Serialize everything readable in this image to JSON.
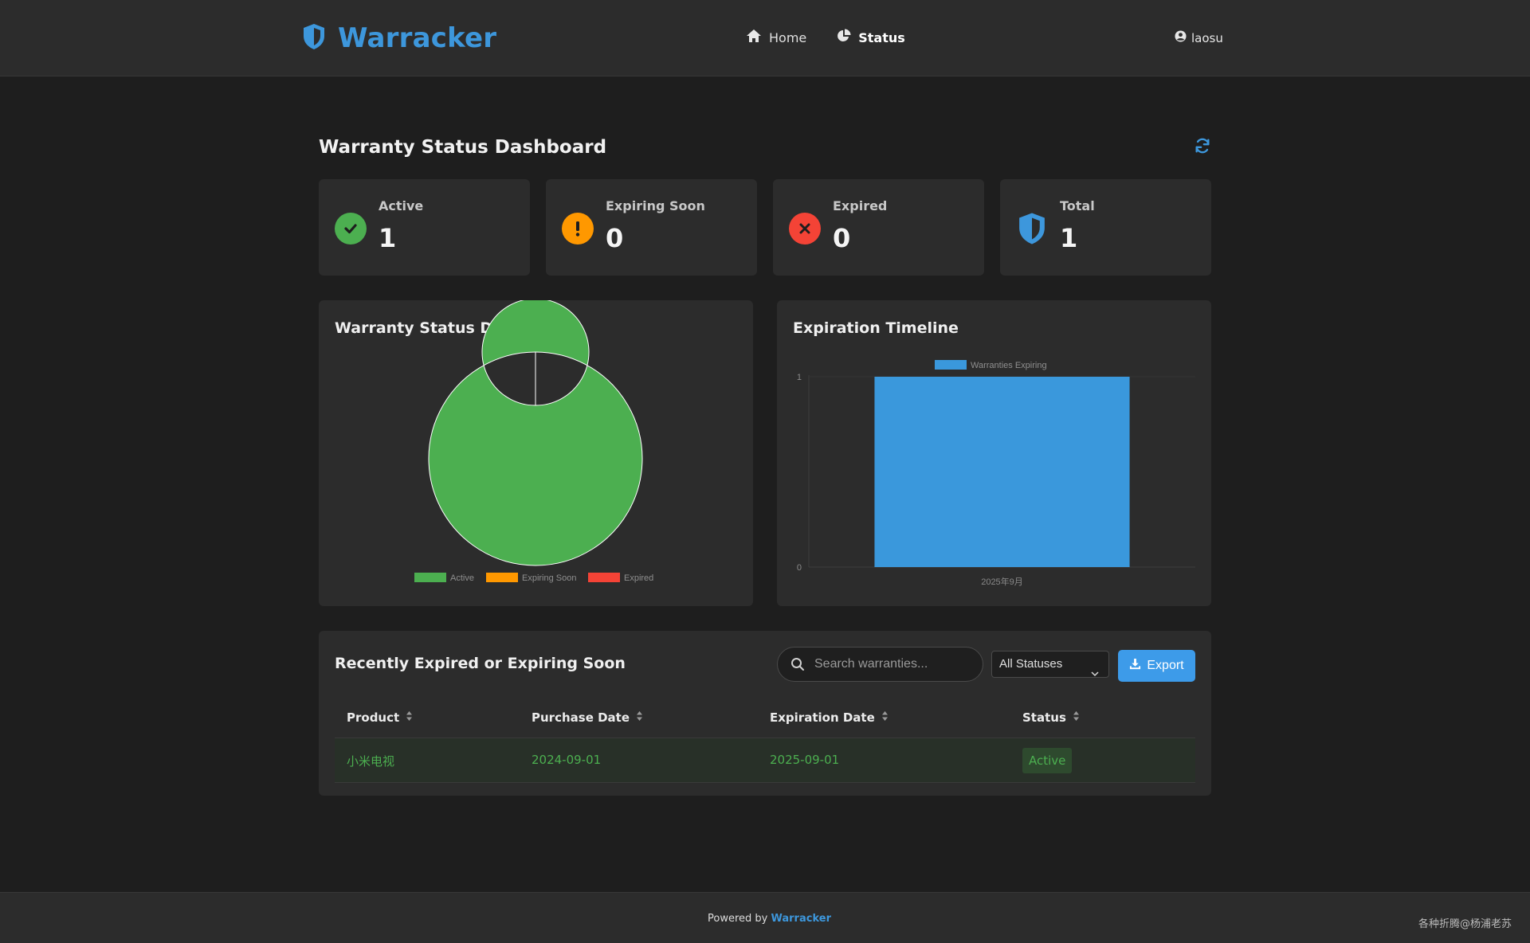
{
  "brand": {
    "name": "Warracker",
    "accent": "#3d97dc"
  },
  "nav": {
    "items": [
      {
        "label": "Home",
        "icon": "home-icon",
        "active": false
      },
      {
        "label": "Status",
        "icon": "pie-chart-icon",
        "active": true
      }
    ]
  },
  "user": {
    "name": "laosu",
    "icon": "user-circle-icon"
  },
  "page": {
    "title": "Warranty Status Dashboard",
    "refresh_icon": "refresh-icon"
  },
  "stats": [
    {
      "label": "Active",
      "value": "1",
      "icon": "check-icon",
      "color": "#4caf50"
    },
    {
      "label": "Expiring Soon",
      "value": "0",
      "icon": "exclamation-icon",
      "color": "#ff9800"
    },
    {
      "label": "Expired",
      "value": "0",
      "icon": "x-icon",
      "color": "#f44336"
    },
    {
      "label": "Total",
      "value": "1",
      "icon": "shield-icon",
      "color": "#3d97dc"
    }
  ],
  "charts": {
    "distribution_title": "Warranty Status Distribution",
    "timeline_title": "Expiration Timeline"
  },
  "chart_data": [
    {
      "type": "pie",
      "title": "Warranty Status Distribution",
      "categories": [
        "Active",
        "Expiring Soon",
        "Expired"
      ],
      "values": [
        1,
        0,
        0
      ],
      "colors": [
        "#4caf50",
        "#ff9800",
        "#f44336"
      ],
      "donut": true,
      "legend": "bottom"
    },
    {
      "type": "bar",
      "title": "Expiration Timeline",
      "categories": [
        "2025年9月"
      ],
      "series": [
        {
          "name": "Warranties Expiring",
          "values": [
            1
          ],
          "color": "#3a98dc"
        }
      ],
      "ylim": [
        0,
        1
      ],
      "yticks": [
        "0",
        "1"
      ],
      "legend": "top"
    }
  ],
  "table": {
    "title": "Recently Expired or Expiring Soon",
    "search_placeholder": "Search warranties...",
    "status_filter": "All Statuses",
    "export_label": "Export",
    "columns": [
      "Product",
      "Purchase Date",
      "Expiration Date",
      "Status"
    ],
    "rows": [
      {
        "product": "小米电视",
        "purchase_date": "2024-09-01",
        "expiration_date": "2025-09-01",
        "status": "Active"
      }
    ]
  },
  "footer": {
    "prefix": "Powered by",
    "link": "Warracker",
    "watermark": "各种折腾@杨浦老苏"
  }
}
